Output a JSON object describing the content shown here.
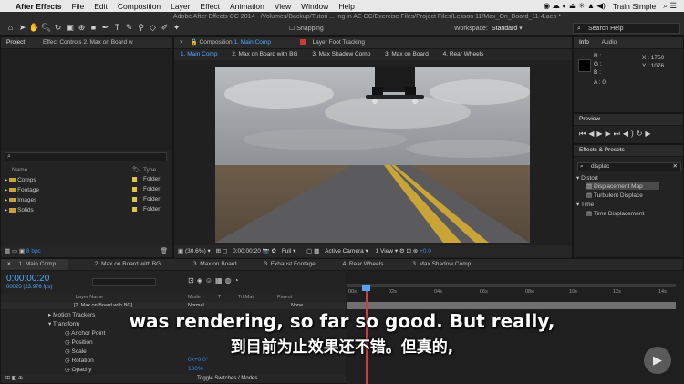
{
  "menubar": {
    "app": "After Effects",
    "items": [
      "File",
      "Edit",
      "Composition",
      "Layer",
      "Effect",
      "Animation",
      "View",
      "Window",
      "Help"
    ],
    "right_app": "Train Simple"
  },
  "window_title": "Adobe After Effects CC 2014 - /Volumes/Backup/Tutori ... ing in AE CC/Exercise Files/Project Files/Lesson 11/Max_On_Board_11-4.aep *",
  "toolbar": {
    "snapping": "Snapping",
    "workspace_label": "Workspace:",
    "workspace_value": "Standard",
    "search_placeholder": "Search Help"
  },
  "project_panel": {
    "tab": "Project",
    "tab2": "Effect Controls 2. Max on Board w",
    "col_name": "Name",
    "col_type": "Type",
    "items": [
      {
        "name": "Comps",
        "type": "Folder"
      },
      {
        "name": "Footage",
        "type": "Folder"
      },
      {
        "name": "Images",
        "type": "Folder"
      },
      {
        "name": "Solids",
        "type": "Folder"
      }
    ],
    "bpc": "8 bpc"
  },
  "composition_panel": {
    "tab": "Composition",
    "tab_comp": "1. Main Comp",
    "tab_layer": "Layer Foot Tracking",
    "comp_tabs": [
      "1. Main Comp",
      "2. Max on Board with BG",
      "3. Max Shadow Comp",
      "3. Max on Board",
      "4. Rear Wheels"
    ],
    "zoom": "(30.6%)",
    "timecode": "0:00:00:20",
    "resolution": "Full",
    "camera": "Active Camera",
    "view": "1 View",
    "exposure": "+0.0"
  },
  "info_panel": {
    "tab": "Info",
    "tab2": "Audio",
    "r": "R :",
    "g": "G :",
    "b": "B :",
    "a": "A : 0",
    "x": "X : 1750",
    "y": "Y : 1076"
  },
  "preview_panel": {
    "tab": "Preview"
  },
  "effects_panel": {
    "tab": "Effects & Presets",
    "search": "displac",
    "groups": [
      {
        "name": "Distort",
        "items": [
          "Displacement Map",
          "Turbulent Displace"
        ]
      },
      {
        "name": "Time",
        "items": [
          "Time Displacement"
        ]
      }
    ]
  },
  "timeline": {
    "tabs": [
      "1. Main Comp",
      "2. Max on Board with BG",
      "3. Max on Board",
      "3. Exhaust Footage",
      "4. Rear Wheels",
      "3. Max Shadow Comp"
    ],
    "timecode": "0:00:00:20",
    "fps": "00020 (23.976 fps)",
    "col_layer": "Layer Name",
    "col_mode": "Mode",
    "col_trkmat": "TrkMat",
    "col_parent": "Parent",
    "layer_name": "[2. Max on Board with BG]",
    "layer_mode": "Normal",
    "layer_parent": "None",
    "props": [
      "Motion Trackers",
      "Transform",
      "Anchor Point",
      "Position",
      "Scale",
      "Rotation",
      "Opacity"
    ],
    "rotation_value": "0x+0.0°",
    "opacity_value": "100%",
    "ruler": [
      "00s",
      "02s",
      "04s",
      "06s",
      "08s",
      "10s",
      "12s",
      "14s"
    ],
    "toggle": "Toggle Switches / Modes"
  },
  "subtitles": {
    "english": "was rendering, so far so good. But really,",
    "chinese": "到目前为止效果还不错。但真的,"
  }
}
